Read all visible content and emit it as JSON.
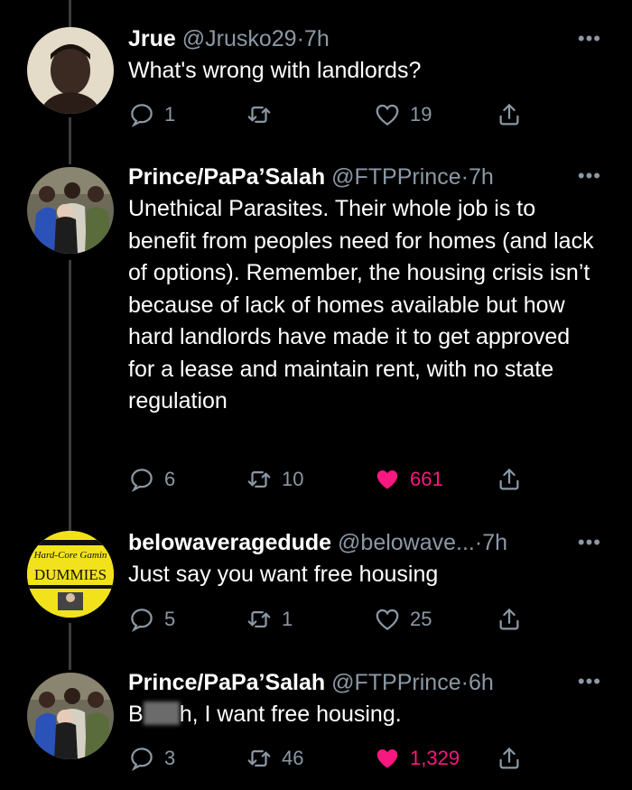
{
  "tweets": [
    {
      "name": "Jrue",
      "handle": "@Jrusko29",
      "dot": "·",
      "time": "7h",
      "more": "•••",
      "text": "What's wrong with landlords?",
      "replies": "1",
      "retweets": "",
      "likes": "19",
      "liked": false,
      "avatar_icon": "person-avatar-icon"
    },
    {
      "name": "Prince/PaPa’Salah",
      "handle": "@FTPPrince",
      "dot": "·",
      "time": "7h",
      "more": "•••",
      "text": "Unethical Parasites. Their whole job is to benefit from peoples need for homes (and lack of options). Remember, the housing crisis isn’t because of lack of homes available but how hard landlords have made it to get approved for a lease and maintain rent, with no state regulation",
      "replies": "6",
      "retweets": "10",
      "likes": "661",
      "liked": true,
      "avatar_icon": "group-photo-avatar-icon"
    },
    {
      "name": "belowaveragedude",
      "handle": "@belowave...",
      "dot": "·",
      "time": "7h",
      "more": "•••",
      "text": "Just say you want free housing",
      "replies": "5",
      "retweets": "1",
      "likes": "25",
      "liked": false,
      "avatar_icon": "book-cover-avatar-icon",
      "avatar_text": {
        "line1": "Hard-Core Gamin",
        "line2": "DUMMIES"
      }
    },
    {
      "name": "Prince/PaPa’Salah",
      "handle": "@FTPPrince",
      "dot": "·",
      "time": "6h",
      "more": "•••",
      "text_start": "B",
      "text_end": "h, I want free housing.",
      "replies": "3",
      "retweets": "46",
      "likes": "1,329",
      "liked": true,
      "avatar_icon": "group-photo-avatar-icon"
    }
  ],
  "colors": {
    "background": "#000000",
    "secondary_text": "#8b98a5",
    "like": "#f91880",
    "thread_line": "#3a3d40"
  }
}
